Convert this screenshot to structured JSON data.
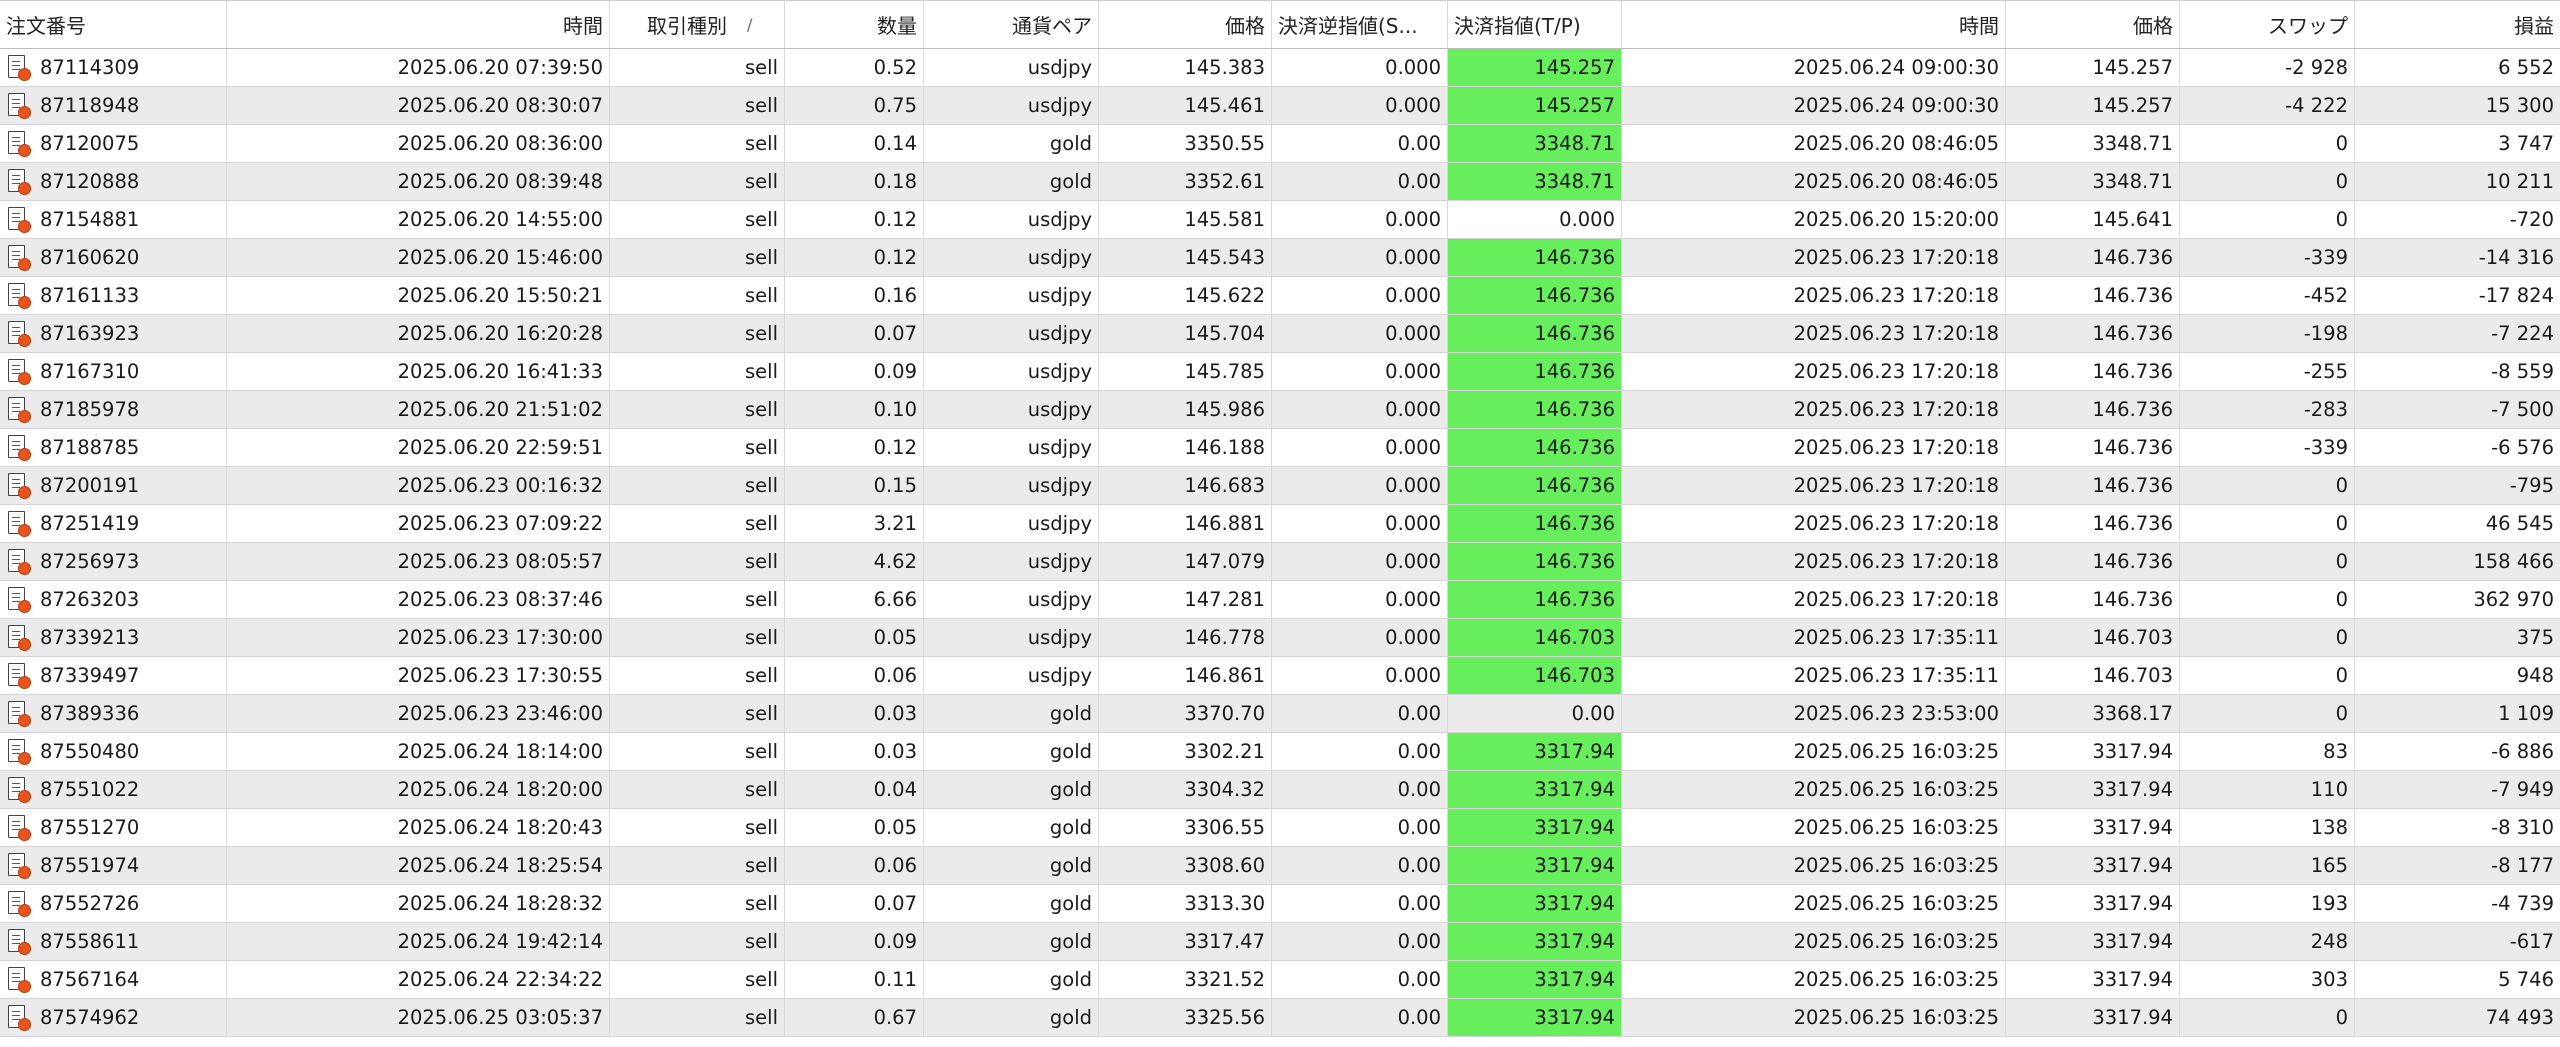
{
  "columns": [
    {
      "label": "注文番号"
    },
    {
      "label": "時間"
    },
    {
      "label": "取引種別",
      "sort": "/"
    },
    {
      "label": "数量"
    },
    {
      "label": "通貨ペア"
    },
    {
      "label": "価格"
    },
    {
      "label": "決済逆指値(S..."
    },
    {
      "label": "決済指値(T/P)"
    },
    {
      "label": "時間"
    },
    {
      "label": "価格"
    },
    {
      "label": "スワップ"
    },
    {
      "label": "損益"
    }
  ],
  "colors": {
    "tp_highlight": "#66ee5c",
    "row_alt": "#ebebeb"
  },
  "icons": {
    "row": "closed-order-document-icon"
  },
  "rows": [
    {
      "order": "87114309",
      "open_time": "2025.06.20 07:39:50",
      "type": "sell",
      "volume": "0.52",
      "symbol": "usdjpy",
      "price": "145.383",
      "sl": "0.000",
      "tp": "145.257",
      "tp_hit": true,
      "close_time": "2025.06.24 09:00:30",
      "close_price": "145.257",
      "swap": "-2 928",
      "profit": "6 552"
    },
    {
      "order": "87118948",
      "open_time": "2025.06.20 08:30:07",
      "type": "sell",
      "volume": "0.75",
      "symbol": "usdjpy",
      "price": "145.461",
      "sl": "0.000",
      "tp": "145.257",
      "tp_hit": true,
      "close_time": "2025.06.24 09:00:30",
      "close_price": "145.257",
      "swap": "-4 222",
      "profit": "15 300"
    },
    {
      "order": "87120075",
      "open_time": "2025.06.20 08:36:00",
      "type": "sell",
      "volume": "0.14",
      "symbol": "gold",
      "price": "3350.55",
      "sl": "0.00",
      "tp": "3348.71",
      "tp_hit": true,
      "close_time": "2025.06.20 08:46:05",
      "close_price": "3348.71",
      "swap": "0",
      "profit": "3 747"
    },
    {
      "order": "87120888",
      "open_time": "2025.06.20 08:39:48",
      "type": "sell",
      "volume": "0.18",
      "symbol": "gold",
      "price": "3352.61",
      "sl": "0.00",
      "tp": "3348.71",
      "tp_hit": true,
      "close_time": "2025.06.20 08:46:05",
      "close_price": "3348.71",
      "swap": "0",
      "profit": "10 211"
    },
    {
      "order": "87154881",
      "open_time": "2025.06.20 14:55:00",
      "type": "sell",
      "volume": "0.12",
      "symbol": "usdjpy",
      "price": "145.581",
      "sl": "0.000",
      "tp": "0.000",
      "tp_hit": false,
      "close_time": "2025.06.20 15:20:00",
      "close_price": "145.641",
      "swap": "0",
      "profit": "-720"
    },
    {
      "order": "87160620",
      "open_time": "2025.06.20 15:46:00",
      "type": "sell",
      "volume": "0.12",
      "symbol": "usdjpy",
      "price": "145.543",
      "sl": "0.000",
      "tp": "146.736",
      "tp_hit": true,
      "close_time": "2025.06.23 17:20:18",
      "close_price": "146.736",
      "swap": "-339",
      "profit": "-14 316"
    },
    {
      "order": "87161133",
      "open_time": "2025.06.20 15:50:21",
      "type": "sell",
      "volume": "0.16",
      "symbol": "usdjpy",
      "price": "145.622",
      "sl": "0.000",
      "tp": "146.736",
      "tp_hit": true,
      "close_time": "2025.06.23 17:20:18",
      "close_price": "146.736",
      "swap": "-452",
      "profit": "-17 824"
    },
    {
      "order": "87163923",
      "open_time": "2025.06.20 16:20:28",
      "type": "sell",
      "volume": "0.07",
      "symbol": "usdjpy",
      "price": "145.704",
      "sl": "0.000",
      "tp": "146.736",
      "tp_hit": true,
      "close_time": "2025.06.23 17:20:18",
      "close_price": "146.736",
      "swap": "-198",
      "profit": "-7 224"
    },
    {
      "order": "87167310",
      "open_time": "2025.06.20 16:41:33",
      "type": "sell",
      "volume": "0.09",
      "symbol": "usdjpy",
      "price": "145.785",
      "sl": "0.000",
      "tp": "146.736",
      "tp_hit": true,
      "close_time": "2025.06.23 17:20:18",
      "close_price": "146.736",
      "swap": "-255",
      "profit": "-8 559"
    },
    {
      "order": "87185978",
      "open_time": "2025.06.20 21:51:02",
      "type": "sell",
      "volume": "0.10",
      "symbol": "usdjpy",
      "price": "145.986",
      "sl": "0.000",
      "tp": "146.736",
      "tp_hit": true,
      "close_time": "2025.06.23 17:20:18",
      "close_price": "146.736",
      "swap": "-283",
      "profit": "-7 500"
    },
    {
      "order": "87188785",
      "open_time": "2025.06.20 22:59:51",
      "type": "sell",
      "volume": "0.12",
      "symbol": "usdjpy",
      "price": "146.188",
      "sl": "0.000",
      "tp": "146.736",
      "tp_hit": true,
      "close_time": "2025.06.23 17:20:18",
      "close_price": "146.736",
      "swap": "-339",
      "profit": "-6 576"
    },
    {
      "order": "87200191",
      "open_time": "2025.06.23 00:16:32",
      "type": "sell",
      "volume": "0.15",
      "symbol": "usdjpy",
      "price": "146.683",
      "sl": "0.000",
      "tp": "146.736",
      "tp_hit": true,
      "close_time": "2025.06.23 17:20:18",
      "close_price": "146.736",
      "swap": "0",
      "profit": "-795"
    },
    {
      "order": "87251419",
      "open_time": "2025.06.23 07:09:22",
      "type": "sell",
      "volume": "3.21",
      "symbol": "usdjpy",
      "price": "146.881",
      "sl": "0.000",
      "tp": "146.736",
      "tp_hit": true,
      "close_time": "2025.06.23 17:20:18",
      "close_price": "146.736",
      "swap": "0",
      "profit": "46 545"
    },
    {
      "order": "87256973",
      "open_time": "2025.06.23 08:05:57",
      "type": "sell",
      "volume": "4.62",
      "symbol": "usdjpy",
      "price": "147.079",
      "sl": "0.000",
      "tp": "146.736",
      "tp_hit": true,
      "close_time": "2025.06.23 17:20:18",
      "close_price": "146.736",
      "swap": "0",
      "profit": "158 466"
    },
    {
      "order": "87263203",
      "open_time": "2025.06.23 08:37:46",
      "type": "sell",
      "volume": "6.66",
      "symbol": "usdjpy",
      "price": "147.281",
      "sl": "0.000",
      "tp": "146.736",
      "tp_hit": true,
      "close_time": "2025.06.23 17:20:18",
      "close_price": "146.736",
      "swap": "0",
      "profit": "362 970"
    },
    {
      "order": "87339213",
      "open_time": "2025.06.23 17:30:00",
      "type": "sell",
      "volume": "0.05",
      "symbol": "usdjpy",
      "price": "146.778",
      "sl": "0.000",
      "tp": "146.703",
      "tp_hit": true,
      "close_time": "2025.06.23 17:35:11",
      "close_price": "146.703",
      "swap": "0",
      "profit": "375"
    },
    {
      "order": "87339497",
      "open_time": "2025.06.23 17:30:55",
      "type": "sell",
      "volume": "0.06",
      "symbol": "usdjpy",
      "price": "146.861",
      "sl": "0.000",
      "tp": "146.703",
      "tp_hit": true,
      "close_time": "2025.06.23 17:35:11",
      "close_price": "146.703",
      "swap": "0",
      "profit": "948"
    },
    {
      "order": "87389336",
      "open_time": "2025.06.23 23:46:00",
      "type": "sell",
      "volume": "0.03",
      "symbol": "gold",
      "price": "3370.70",
      "sl": "0.00",
      "tp": "0.00",
      "tp_hit": false,
      "close_time": "2025.06.23 23:53:00",
      "close_price": "3368.17",
      "swap": "0",
      "profit": "1 109"
    },
    {
      "order": "87550480",
      "open_time": "2025.06.24 18:14:00",
      "type": "sell",
      "volume": "0.03",
      "symbol": "gold",
      "price": "3302.21",
      "sl": "0.00",
      "tp": "3317.94",
      "tp_hit": true,
      "close_time": "2025.06.25 16:03:25",
      "close_price": "3317.94",
      "swap": "83",
      "profit": "-6 886"
    },
    {
      "order": "87551022",
      "open_time": "2025.06.24 18:20:00",
      "type": "sell",
      "volume": "0.04",
      "symbol": "gold",
      "price": "3304.32",
      "sl": "0.00",
      "tp": "3317.94",
      "tp_hit": true,
      "close_time": "2025.06.25 16:03:25",
      "close_price": "3317.94",
      "swap": "110",
      "profit": "-7 949"
    },
    {
      "order": "87551270",
      "open_time": "2025.06.24 18:20:43",
      "type": "sell",
      "volume": "0.05",
      "symbol": "gold",
      "price": "3306.55",
      "sl": "0.00",
      "tp": "3317.94",
      "tp_hit": true,
      "close_time": "2025.06.25 16:03:25",
      "close_price": "3317.94",
      "swap": "138",
      "profit": "-8 310"
    },
    {
      "order": "87551974",
      "open_time": "2025.06.24 18:25:54",
      "type": "sell",
      "volume": "0.06",
      "symbol": "gold",
      "price": "3308.60",
      "sl": "0.00",
      "tp": "3317.94",
      "tp_hit": true,
      "close_time": "2025.06.25 16:03:25",
      "close_price": "3317.94",
      "swap": "165",
      "profit": "-8 177"
    },
    {
      "order": "87552726",
      "open_time": "2025.06.24 18:28:32",
      "type": "sell",
      "volume": "0.07",
      "symbol": "gold",
      "price": "3313.30",
      "sl": "0.00",
      "tp": "3317.94",
      "tp_hit": true,
      "close_time": "2025.06.25 16:03:25",
      "close_price": "3317.94",
      "swap": "193",
      "profit": "-4 739"
    },
    {
      "order": "87558611",
      "open_time": "2025.06.24 19:42:14",
      "type": "sell",
      "volume": "0.09",
      "symbol": "gold",
      "price": "3317.47",
      "sl": "0.00",
      "tp": "3317.94",
      "tp_hit": true,
      "close_time": "2025.06.25 16:03:25",
      "close_price": "3317.94",
      "swap": "248",
      "profit": "-617"
    },
    {
      "order": "87567164",
      "open_time": "2025.06.24 22:34:22",
      "type": "sell",
      "volume": "0.11",
      "symbol": "gold",
      "price": "3321.52",
      "sl": "0.00",
      "tp": "3317.94",
      "tp_hit": true,
      "close_time": "2025.06.25 16:03:25",
      "close_price": "3317.94",
      "swap": "303",
      "profit": "5 746"
    },
    {
      "order": "87574962",
      "open_time": "2025.06.25 03:05:37",
      "type": "sell",
      "volume": "0.67",
      "symbol": "gold",
      "price": "3325.56",
      "sl": "0.00",
      "tp": "3317.94",
      "tp_hit": true,
      "close_time": "2025.06.25 16:03:25",
      "close_price": "3317.94",
      "swap": "0",
      "profit": "74 493"
    }
  ]
}
